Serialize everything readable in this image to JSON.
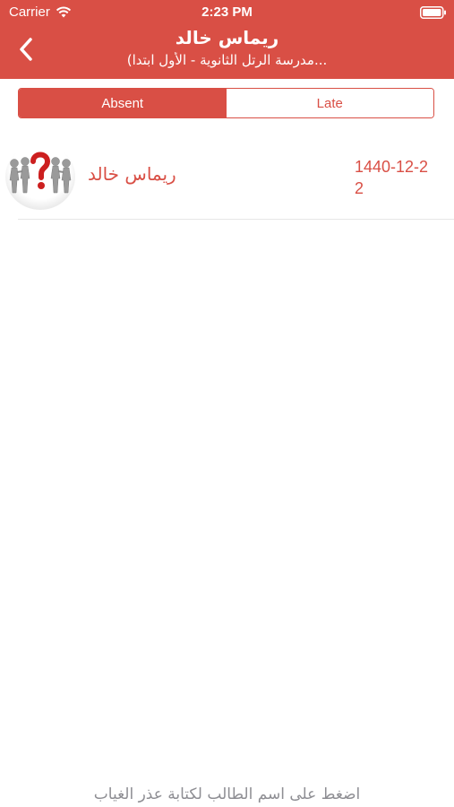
{
  "status_bar": {
    "carrier": "Carrier",
    "time": "2:23 PM"
  },
  "nav": {
    "title": "ريماس خالد",
    "subtitle": "(مدرسة الرتل الثانوية - الأول ابتدا...",
    "back_icon": "chevron-left-icon"
  },
  "segments": [
    {
      "label": "Absent",
      "selected": true
    },
    {
      "label": "Late",
      "selected": false
    }
  ],
  "students": [
    {
      "name": "ريماس خالد",
      "date": "1440-12-22",
      "avatar_icon": "question-people-icon"
    }
  ],
  "footer": {
    "hint": "اضغط على اسم الطالب لكتابة عذر الغياب"
  },
  "colors": {
    "accent": "#d94f45",
    "hint_gray": "#8e8e93"
  }
}
